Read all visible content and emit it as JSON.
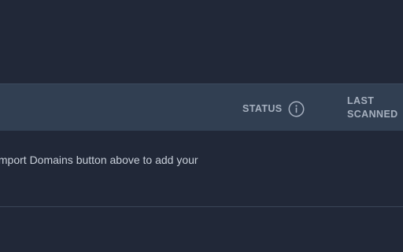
{
  "table": {
    "columns": {
      "status": "STATUS",
      "last_scanned_line1": "LAST",
      "last_scanned_line2": "SCANNED"
    },
    "empty_message": "Import Domains button above to add your"
  },
  "icons": {
    "status_info": "info-circle-icon"
  },
  "colors": {
    "background": "#212838",
    "header_background": "#313f52",
    "header_text": "#a6b0bf",
    "body_text": "#c9d0da"
  }
}
